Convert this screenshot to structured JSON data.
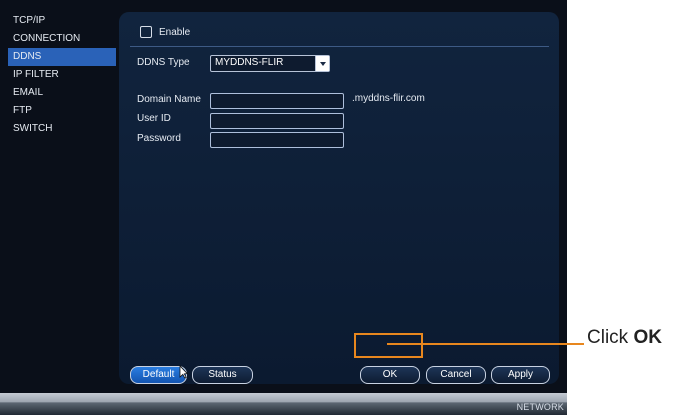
{
  "sidebar": {
    "items": [
      {
        "label": "TCP/IP",
        "active": false
      },
      {
        "label": "CONNECTION",
        "active": false
      },
      {
        "label": "DDNS",
        "active": true
      },
      {
        "label": "IP FILTER",
        "active": false
      },
      {
        "label": "EMAIL",
        "active": false
      },
      {
        "label": "FTP",
        "active": false
      },
      {
        "label": "SWITCH",
        "active": false
      }
    ]
  },
  "form": {
    "enable_label": "Enable",
    "ddns_type_label": "DDNS Type",
    "ddns_type_value": "MYDDNS-FLIR",
    "domain_name_label": "Domain Name",
    "domain_suffix": ".myddns-flir.com",
    "user_id_label": "User ID",
    "password_label": "Password",
    "domain_name_value": "",
    "user_id_value": "",
    "password_value": ""
  },
  "buttons": {
    "default": "Default",
    "status": "Status",
    "ok": "OK",
    "cancel": "Cancel",
    "apply": "Apply"
  },
  "status_bar": {
    "label": "NETWORK"
  },
  "callout": {
    "prefix": "Click ",
    "bold": "OK"
  },
  "colors": {
    "accent": "#2a62b8",
    "callout": "#e8871e",
    "panel": "#0b1a30"
  }
}
